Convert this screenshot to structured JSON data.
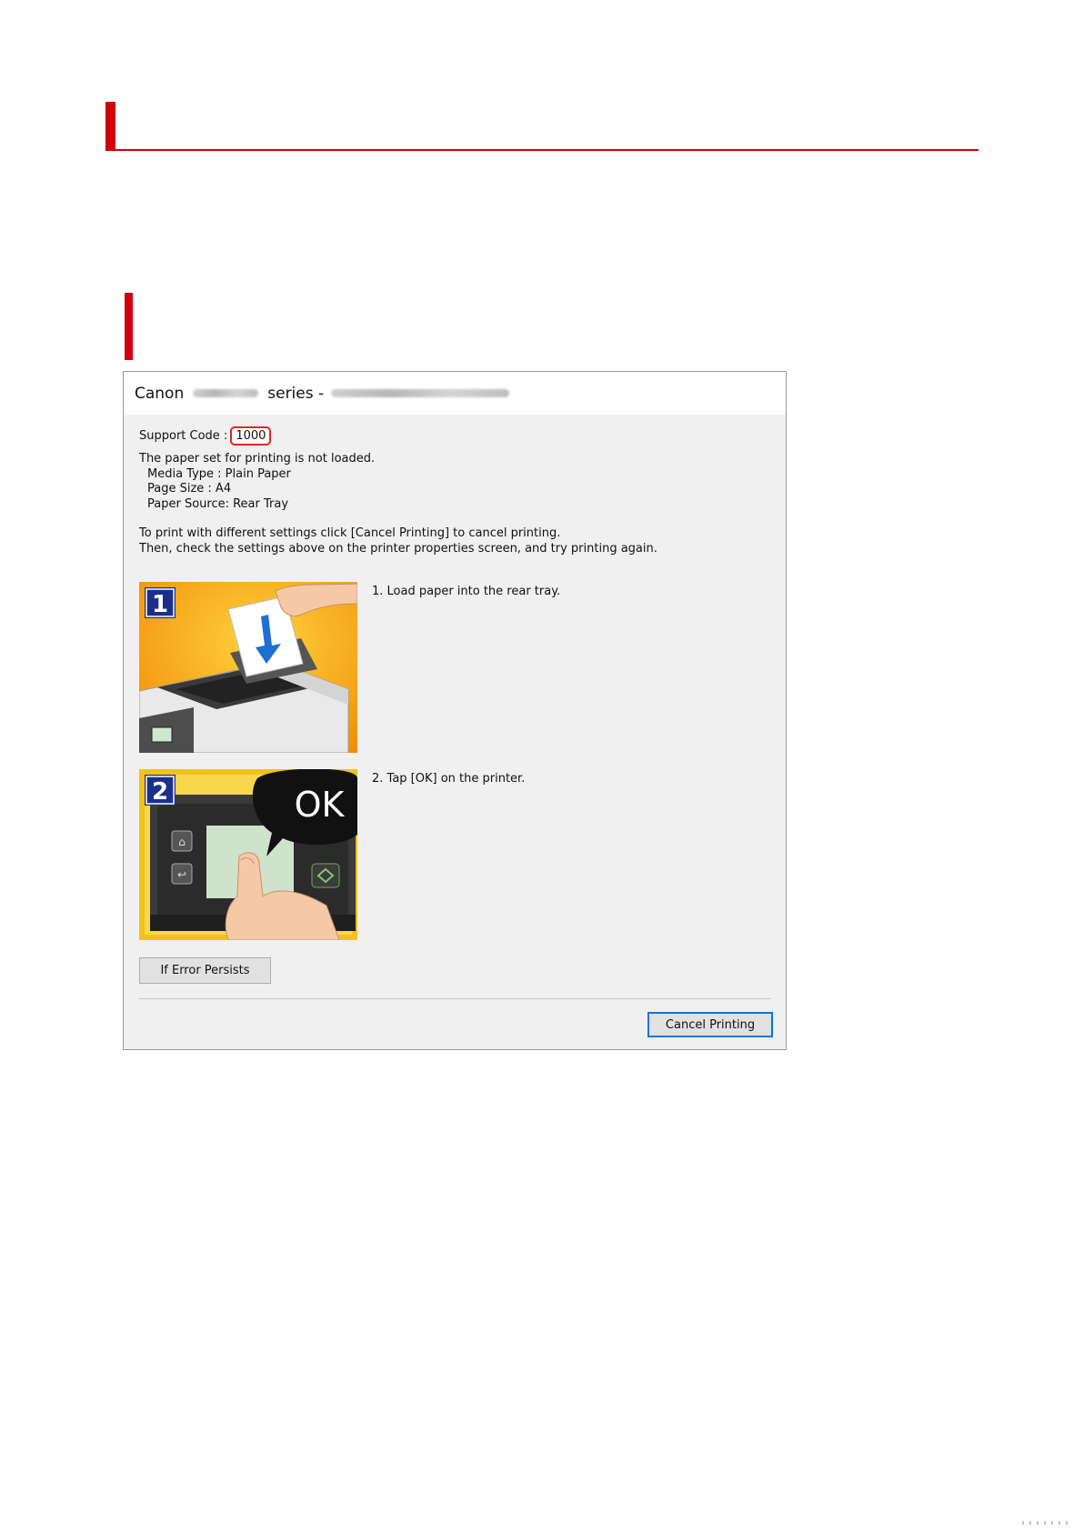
{
  "page": {
    "heading1": "",
    "heading2": ""
  },
  "dialog": {
    "title_prefix": "Canon",
    "title_series": "series -",
    "support_code_label": "Support Code :",
    "support_code": "1000",
    "message_line1": "The paper set for printing is not loaded.",
    "media_type": "Media Type : Plain Paper",
    "page_size": "Page Size : A4",
    "paper_source": "Paper Source: Rear Tray",
    "instruction_line1": "To print with different settings click [Cancel Printing] to cancel printing.",
    "instruction_line2": "Then, check the settings above on the printer properties screen, and try printing again.",
    "steps": [
      {
        "number": "1",
        "text": "1.  Load paper into the rear tray."
      },
      {
        "number": "2",
        "text": "2.  Tap [OK] on the printer.",
        "callout": "OK"
      }
    ],
    "if_error_button": "If Error Persists",
    "cancel_button": "Cancel Printing",
    "accent_color": "#d2000f",
    "highlight_color": "#e0261f",
    "focus_color": "#0078d7"
  }
}
